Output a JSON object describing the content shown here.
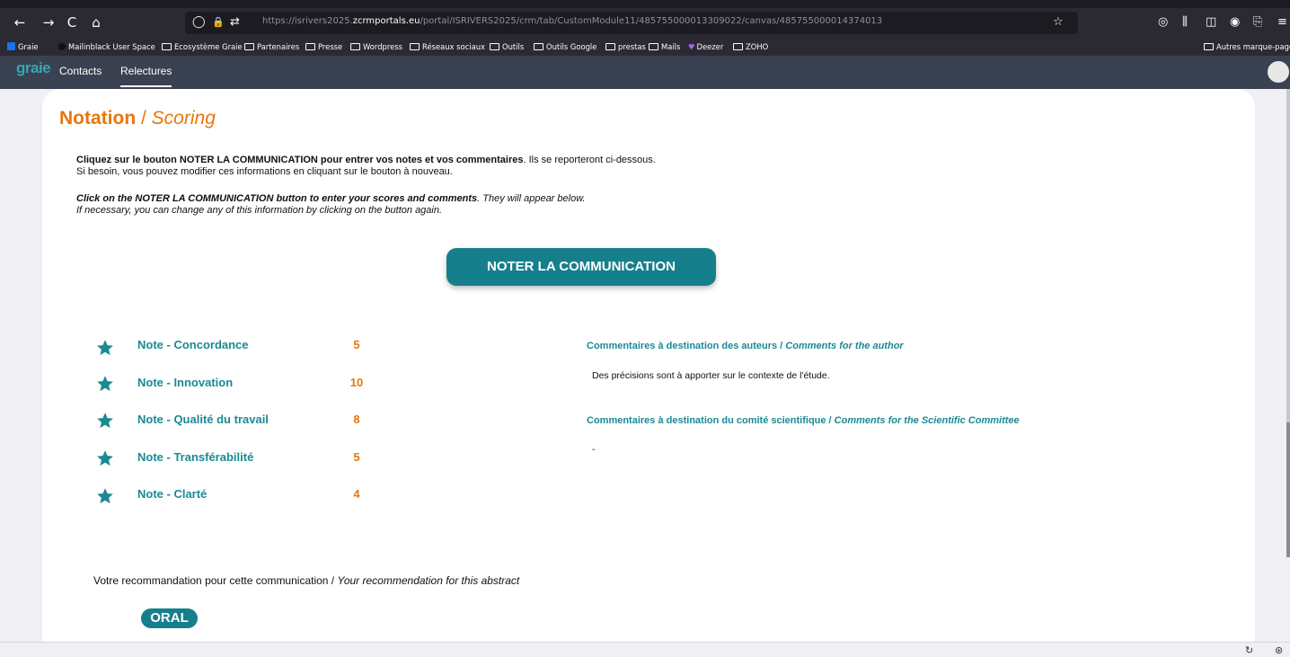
{
  "browser": {
    "url_prefix": "https://isrivers2025.",
    "url_domain": "zcrmportals.eu",
    "url_path": "/portal/ISRIVERS2025/crm/tab/CustomModule11/485755000013309022/canvas/485755000014374013",
    "nav_icons": {
      "back": "←",
      "forward": "→",
      "reload": "C",
      "home": "⌂"
    },
    "right_icons": {
      "pocket": "◎",
      "library": "⫼",
      "sidebar": "◫",
      "account": "◉",
      "extensions": "⎘",
      "menu": "≡"
    },
    "url_icons": {
      "shield": "◯",
      "lock": "🔒",
      "permissions": "⇄",
      "star": "☆"
    }
  },
  "bookmarks": [
    {
      "label": "Graie",
      "icon": "square"
    },
    {
      "label": "Mailinblack User Space",
      "icon": "dot"
    },
    {
      "label": "Ecosystème Graie",
      "icon": "folder"
    },
    {
      "label": "Partenaires",
      "icon": "folder"
    },
    {
      "label": "Presse",
      "icon": "folder"
    },
    {
      "label": "Wordpress",
      "icon": "folder"
    },
    {
      "label": "Réseaux sociaux",
      "icon": "folder"
    },
    {
      "label": "Outils",
      "icon": "folder"
    },
    {
      "label": "Outils Google",
      "icon": "folder"
    },
    {
      "label": "prestas",
      "icon": "folder"
    },
    {
      "label": "Mails",
      "icon": "folder"
    },
    {
      "label": "Deezer",
      "icon": "heart"
    },
    {
      "label": "ZOHO",
      "icon": "folder"
    }
  ],
  "bookmarks_other": "Autres marque-pages",
  "app": {
    "logo": "graie",
    "nav": [
      {
        "label": "Contacts",
        "active": false
      },
      {
        "label": "Relectures",
        "active": true
      }
    ]
  },
  "heading": {
    "main": "Notation",
    "sep": " / ",
    "sub": "Scoring"
  },
  "instructions": {
    "fr_bold": "Cliquez sur le bouton NOTER LA COMMUNICATION pour entrer vos notes et vos commentaires",
    "fr_rest": ". Ils se reporteront ci-dessous.",
    "fr_line2": "Si besoin, vous pouvez modifier ces informations en cliquant sur le bouton à nouveau.",
    "en_bold": "Click on the NOTER LA COMMUNICATION button to enter your scores and comments",
    "en_rest": ". They will appear below.",
    "en_line2": "If necessary, you can change any of this information by clicking on the button again."
  },
  "cta_label": "NOTER LA COMMUNICATION",
  "notes": [
    {
      "label": "Note - Concordance",
      "value": "5"
    },
    {
      "label": "Note - Innovation",
      "value": "10"
    },
    {
      "label": "Note - Qualité du travail",
      "value": "8"
    },
    {
      "label": "Note - Transférabilité",
      "value": "5"
    },
    {
      "label": "Note - Clarté",
      "value": "4"
    }
  ],
  "comments": {
    "authors_fr": "Commentaires à destination des auteurs / ",
    "authors_en": "Comments for the author",
    "authors_text": "Des précisions sont à apporter sur le contexte de l'étude.",
    "committee_fr": "Commentaires à destination du comité scientifique / ",
    "committee_en": "Comments for the Scientific Committee",
    "committee_text": "-"
  },
  "recommendation": {
    "fr": "Votre recommandation pour cette communication / ",
    "en": "Your recommendation for this abstract",
    "value": "ORAL"
  },
  "colors": {
    "accent_orange": "#e8760b",
    "accent_teal": "#167f8c"
  },
  "status_icons": {
    "sync": "↻",
    "help": "⊛"
  }
}
